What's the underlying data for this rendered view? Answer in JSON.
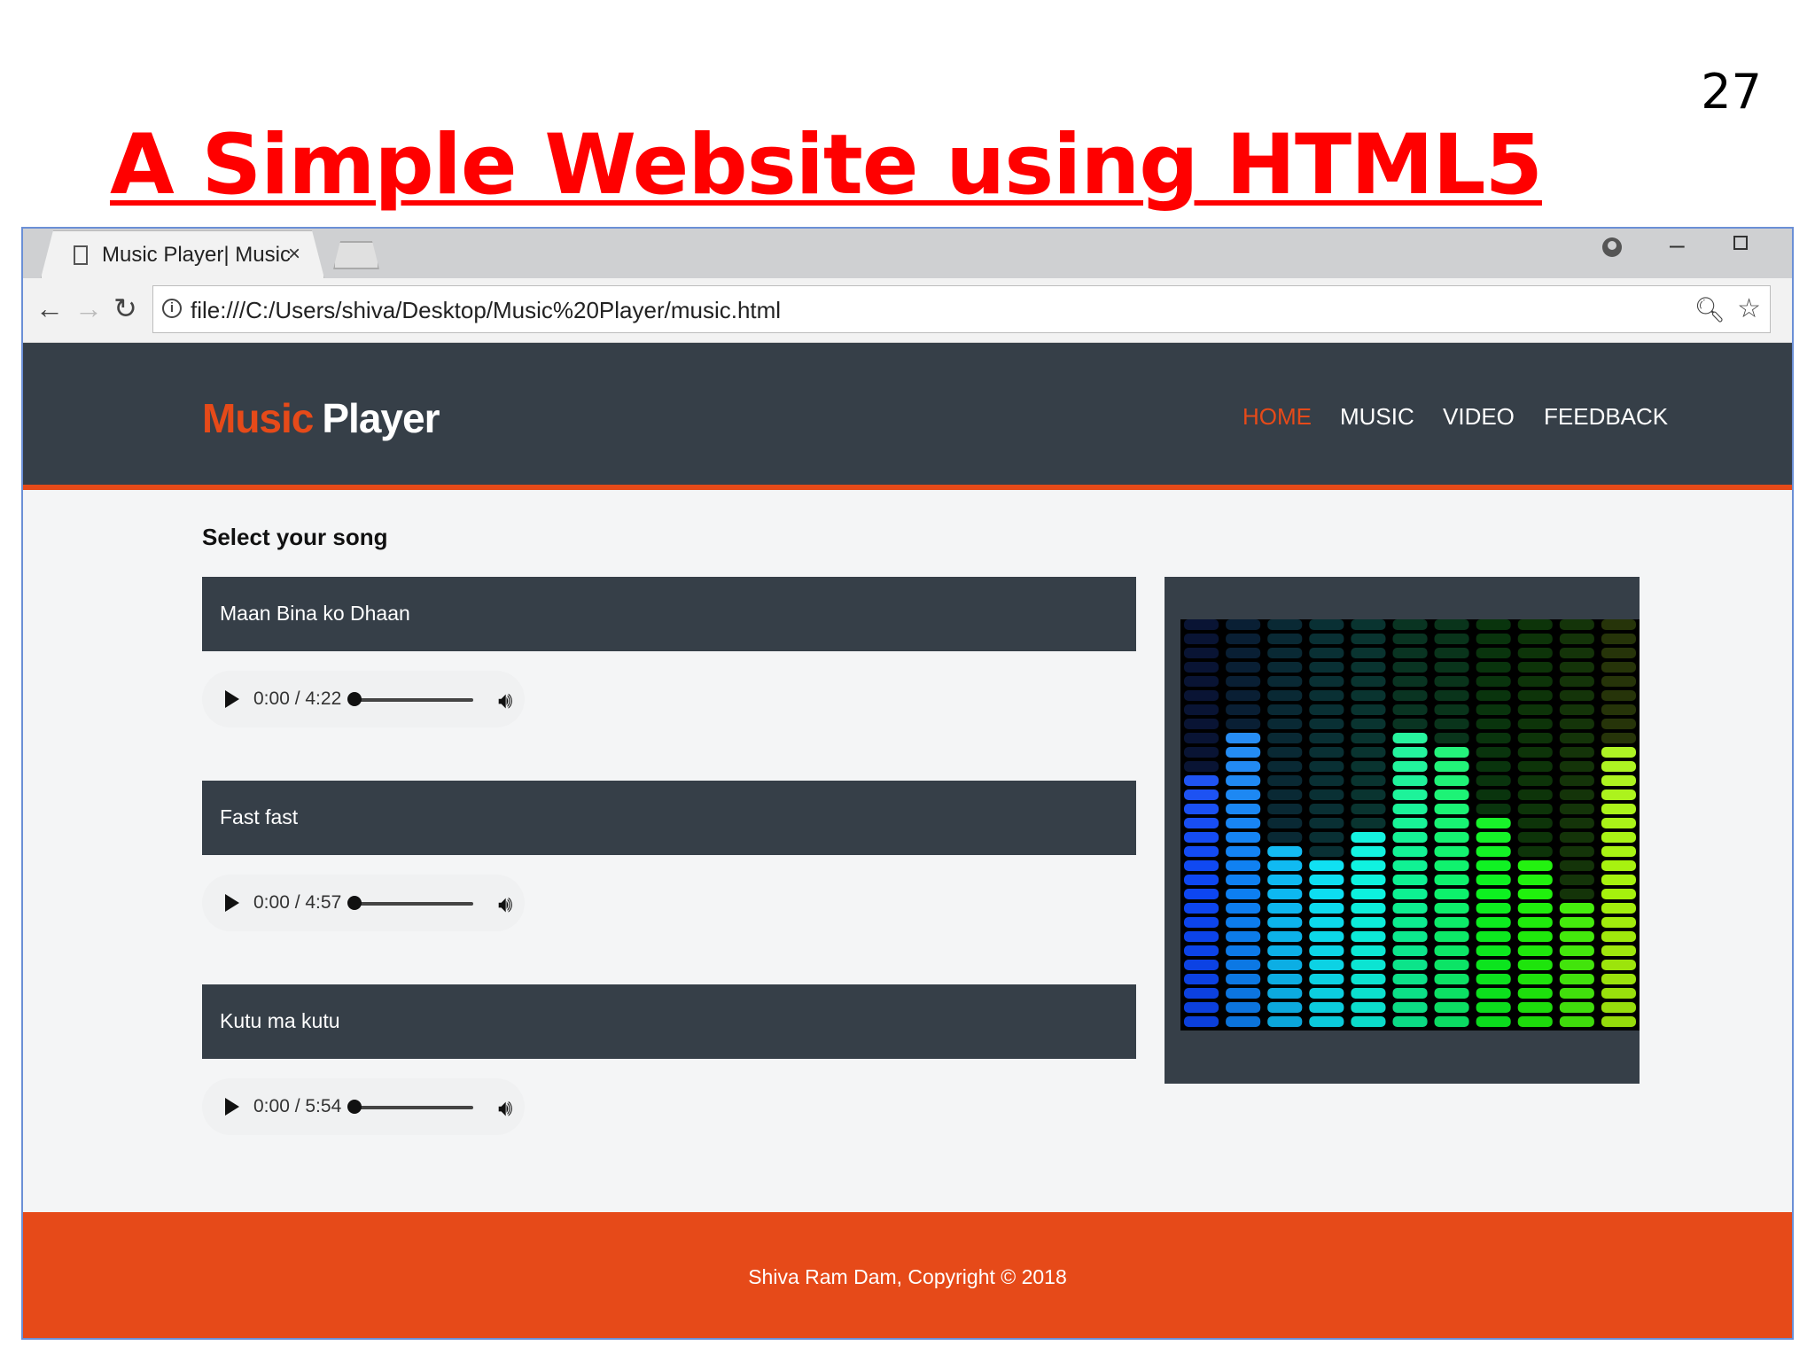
{
  "slide": {
    "number": "27",
    "title": "A Simple Website using HTML5"
  },
  "browser": {
    "tab_title": "Music Player| Music",
    "tab_close": "×",
    "url": "file:///C:/Users/shiva/Desktop/Music%20Player/music.html"
  },
  "site": {
    "logo_part1": "Music",
    "logo_part2": "Player",
    "nav": [
      {
        "label": "HOME",
        "active": true
      },
      {
        "label": "MUSIC",
        "active": false
      },
      {
        "label": "VIDEO",
        "active": false
      },
      {
        "label": "FEEDBACK",
        "active": false
      }
    ],
    "section_title": "Select your song",
    "songs": [
      {
        "title": "Maan Bina ko Dhaan",
        "time": "0:00 / 4:22"
      },
      {
        "title": "Fast fast",
        "time": "0:00 / 4:57"
      },
      {
        "title": "Kutu ma kutu",
        "time": "0:00 / 5:54"
      }
    ],
    "footer": "Shiva Ram Dam, Copyright © 2018"
  },
  "colors": {
    "accent": "#e64a19",
    "header_bg": "#363f48",
    "title_red": "#ff0000"
  },
  "equalizer_levels": [
    0.62,
    0.74,
    0.45,
    0.4,
    0.47,
    0.73,
    0.7,
    0.51,
    0.42,
    0.32,
    0.68
  ]
}
